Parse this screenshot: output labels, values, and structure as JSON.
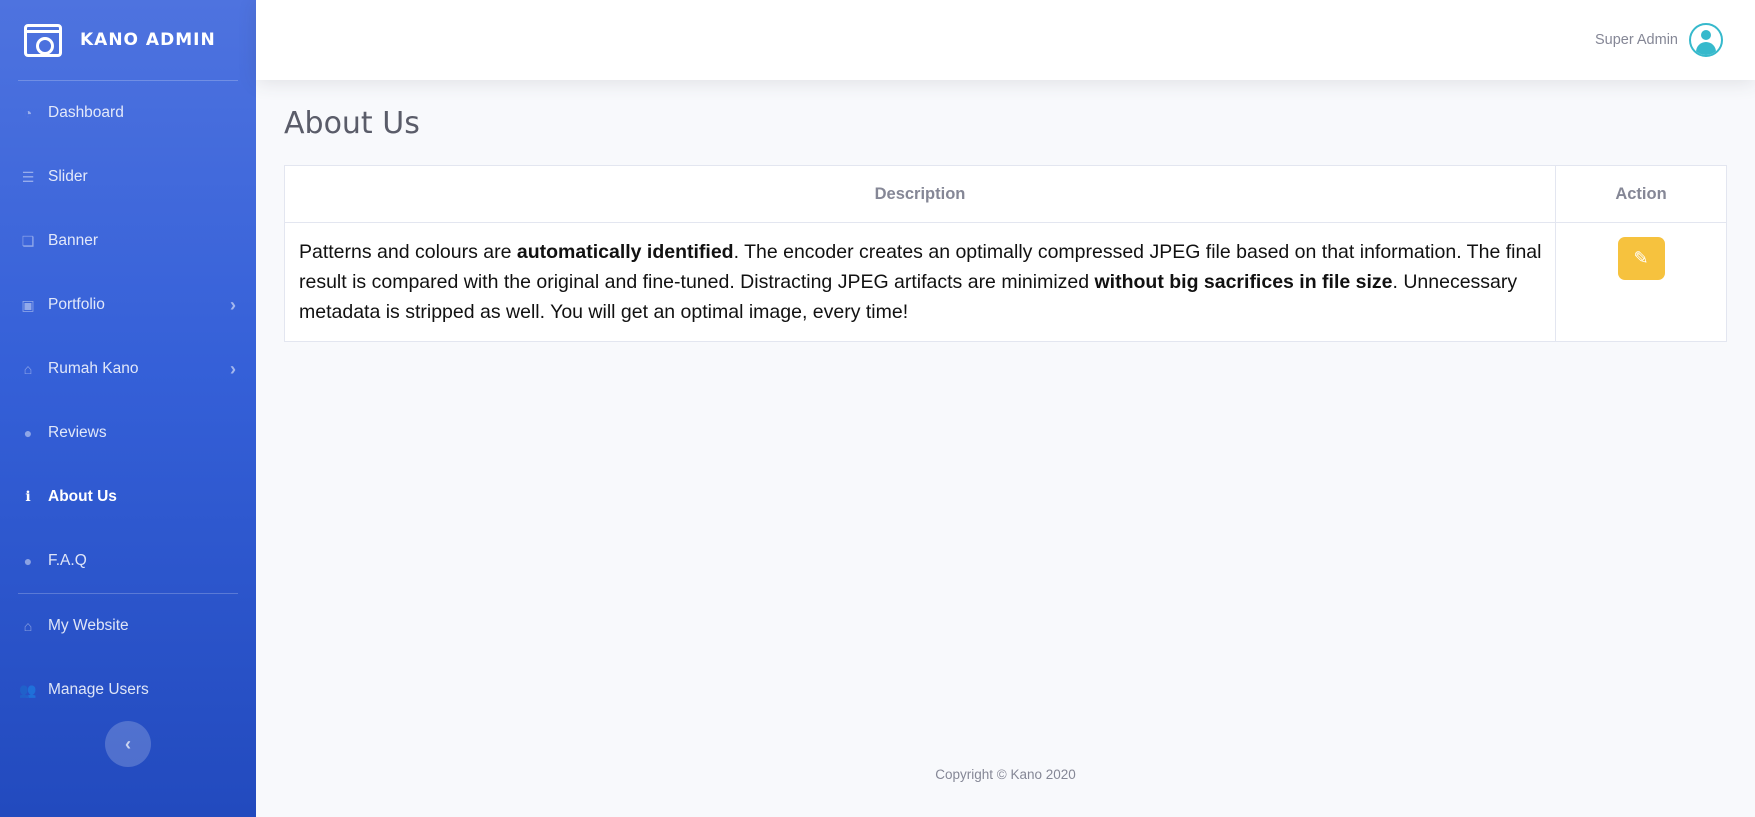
{
  "brand": {
    "name": "KANO ADMIN",
    "logo_icon": "camera-window-icon"
  },
  "sidebar": {
    "items": [
      {
        "label": "Dashboard",
        "icon": "tachometer-icon",
        "glyph": "◔",
        "arrow": ""
      },
      {
        "label": "Slider",
        "icon": "sliders-icon",
        "glyph": "☰",
        "arrow": ""
      },
      {
        "label": "Banner",
        "icon": "images-icon",
        "glyph": "❏",
        "arrow": ""
      },
      {
        "label": "Portfolio",
        "icon": "photo-album-icon",
        "glyph": "▣",
        "arrow": "›"
      },
      {
        "label": "Rumah Kano",
        "icon": "home-icon",
        "glyph": "⌂",
        "arrow": "›"
      },
      {
        "label": "Reviews",
        "icon": "comments-icon",
        "glyph": "●",
        "arrow": ""
      },
      {
        "label": "About Us",
        "icon": "info-icon",
        "glyph": "i",
        "arrow": "",
        "active": true
      },
      {
        "label": "F.A.Q",
        "icon": "comment-icon",
        "glyph": "●",
        "arrow": ""
      }
    ],
    "secondary_items": [
      {
        "label": "My Website",
        "icon": "home-icon",
        "glyph": "⌂"
      },
      {
        "label": "Manage Users",
        "icon": "users-icon",
        "glyph": "👥"
      }
    ],
    "toggle_glyph": "‹"
  },
  "topbar": {
    "user_name": "Super Admin",
    "avatar_icon": "user-circle-icon"
  },
  "main": {
    "title": "About Us",
    "table": {
      "headers": [
        "Description",
        "Action"
      ],
      "rows": [
        {
          "description": {
            "p1": "Patterns and colours are ",
            "b1": "automatically identified",
            "p2": ". The encoder creates an optimally compressed JPEG file based on that information. The final result is compared with the original and fine-tuned. Distracting JPEG artifacts are minimized ",
            "b2": "without big sacrifices in file size",
            "p3": ". Unnecessary metadata is stripped as well. You will get an optimal image, every time!"
          },
          "action_icon": "pencil-icon",
          "action_glyph": "✎"
        }
      ]
    }
  },
  "footer": {
    "copyright": "Copyright © Kano 2020"
  },
  "colors": {
    "sidebar_top": "#4e73df",
    "sidebar_bottom": "#224abe",
    "edit_button": "#f6c23e",
    "avatar": "#36b9cc"
  }
}
